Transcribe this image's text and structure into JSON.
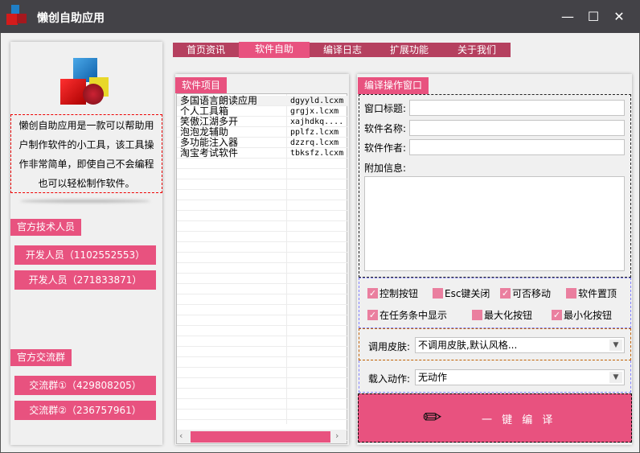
{
  "window": {
    "title": "懒创自助应用",
    "minimize": "—",
    "maximize": "☐",
    "close": "✕"
  },
  "tabs": [
    {
      "label": "首页资讯"
    },
    {
      "label": "软件自助",
      "active": true
    },
    {
      "label": "编译日志"
    },
    {
      "label": "扩展功能"
    },
    {
      "label": "关于我们"
    }
  ],
  "left": {
    "description": [
      "懒创自助应用是一款可以帮助用",
      "户制作软件的小工具，该工具操",
      "作非常简单，即使自己不会编程",
      "也可以轻松制作软件。"
    ],
    "tech_title": "官方技术人员",
    "tech_buttons": [
      "开发人员（1102552553）",
      "开发人员（271833871）"
    ],
    "group_title": "官方交流群",
    "group_buttons": [
      "交流群①（429808205）",
      "交流群②（236757961）"
    ]
  },
  "list": {
    "title": "软件项目",
    "rows": [
      {
        "name": "多国语言朗读应用",
        "file": "dgyyld.lcxm"
      },
      {
        "name": "个人工具箱",
        "file": "grgjx.lcxm"
      },
      {
        "name": "笑傲江湖多开",
        "file": "xajhdkq...."
      },
      {
        "name": "泡泡龙辅助",
        "file": "pplfz.lcxm"
      },
      {
        "name": "多功能注入器",
        "file": "dzzrq.lcxm"
      },
      {
        "name": "淘宝考试软件",
        "file": "tbksfz.lcxm"
      }
    ]
  },
  "editor": {
    "title": "编译操作窗口",
    "window_title_label": "窗口标题:",
    "window_title_value": "",
    "software_name_label": "软件名称:",
    "software_name_value": "",
    "author_label": "软件作者:",
    "author_value": "",
    "extra_label": "附加信息:",
    "extra_value": "",
    "checkboxes": [
      {
        "label": "控制按钮",
        "checked": true
      },
      {
        "label": "Esc键关闭",
        "checked": false
      },
      {
        "label": "可否移动",
        "checked": true
      },
      {
        "label": "软件置顶",
        "checked": false
      },
      {
        "label": "在任务条中显示",
        "checked": true
      },
      {
        "label": "最大化按钮",
        "checked": false
      },
      {
        "label": "最小化按钮",
        "checked": true
      }
    ],
    "skin_label": "调用皮肤:",
    "skin_value": "不调用皮肤,默认风格...",
    "load_label": "载入动作:",
    "load_value": "无动作",
    "compile_label": "一 键 编 译"
  },
  "colors": {
    "accent": "#e8527f",
    "tab": "#b5405f",
    "titlebar": "#434247"
  }
}
